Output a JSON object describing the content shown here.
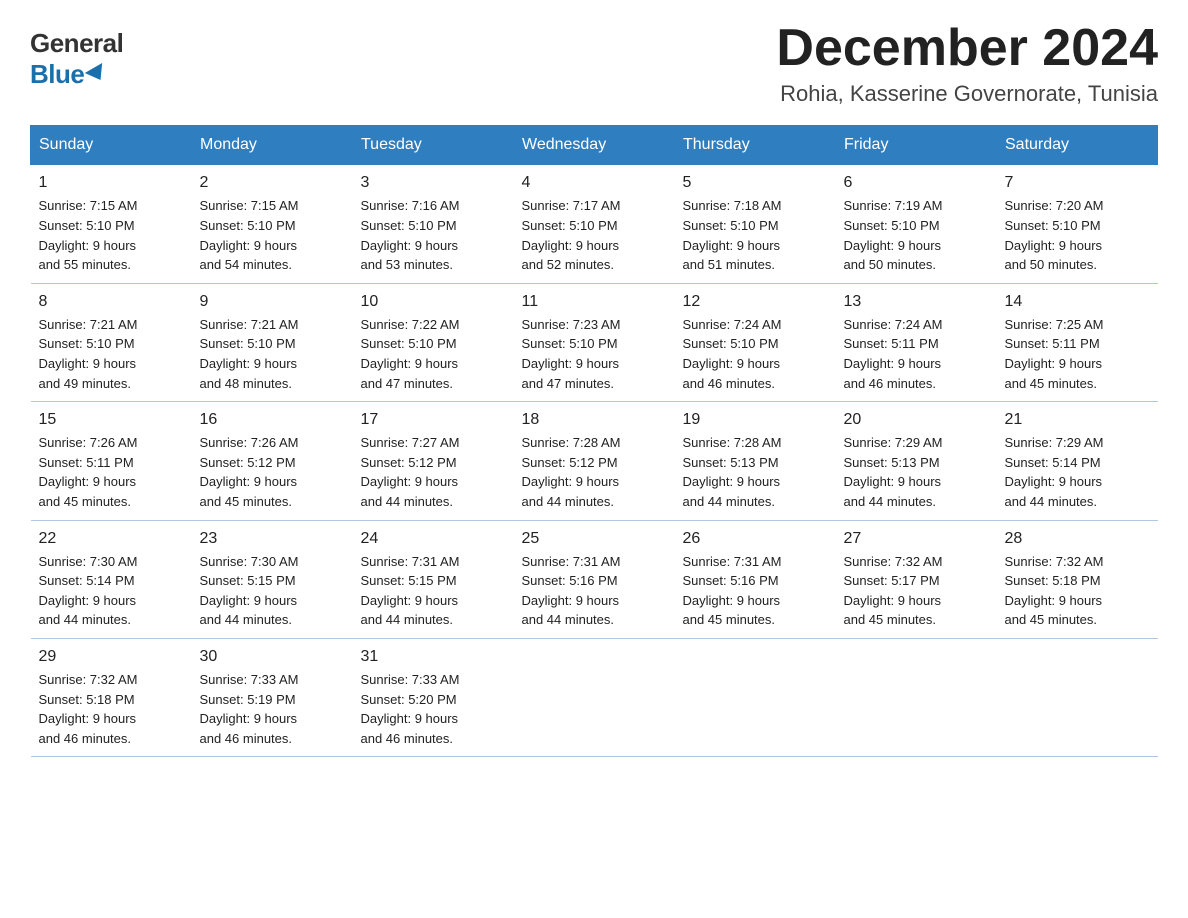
{
  "logo": {
    "general": "General",
    "blue": "Blue"
  },
  "header": {
    "month": "December 2024",
    "location": "Rohia, Kasserine Governorate, Tunisia"
  },
  "days_of_week": [
    "Sunday",
    "Monday",
    "Tuesday",
    "Wednesday",
    "Thursday",
    "Friday",
    "Saturday"
  ],
  "weeks": [
    [
      {
        "day": "1",
        "sunrise": "7:15 AM",
        "sunset": "5:10 PM",
        "daylight": "9 hours and 55 minutes."
      },
      {
        "day": "2",
        "sunrise": "7:15 AM",
        "sunset": "5:10 PM",
        "daylight": "9 hours and 54 minutes."
      },
      {
        "day": "3",
        "sunrise": "7:16 AM",
        "sunset": "5:10 PM",
        "daylight": "9 hours and 53 minutes."
      },
      {
        "day": "4",
        "sunrise": "7:17 AM",
        "sunset": "5:10 PM",
        "daylight": "9 hours and 52 minutes."
      },
      {
        "day": "5",
        "sunrise": "7:18 AM",
        "sunset": "5:10 PM",
        "daylight": "9 hours and 51 minutes."
      },
      {
        "day": "6",
        "sunrise": "7:19 AM",
        "sunset": "5:10 PM",
        "daylight": "9 hours and 50 minutes."
      },
      {
        "day": "7",
        "sunrise": "7:20 AM",
        "sunset": "5:10 PM",
        "daylight": "9 hours and 50 minutes."
      }
    ],
    [
      {
        "day": "8",
        "sunrise": "7:21 AM",
        "sunset": "5:10 PM",
        "daylight": "9 hours and 49 minutes."
      },
      {
        "day": "9",
        "sunrise": "7:21 AM",
        "sunset": "5:10 PM",
        "daylight": "9 hours and 48 minutes."
      },
      {
        "day": "10",
        "sunrise": "7:22 AM",
        "sunset": "5:10 PM",
        "daylight": "9 hours and 47 minutes."
      },
      {
        "day": "11",
        "sunrise": "7:23 AM",
        "sunset": "5:10 PM",
        "daylight": "9 hours and 47 minutes."
      },
      {
        "day": "12",
        "sunrise": "7:24 AM",
        "sunset": "5:10 PM",
        "daylight": "9 hours and 46 minutes."
      },
      {
        "day": "13",
        "sunrise": "7:24 AM",
        "sunset": "5:11 PM",
        "daylight": "9 hours and 46 minutes."
      },
      {
        "day": "14",
        "sunrise": "7:25 AM",
        "sunset": "5:11 PM",
        "daylight": "9 hours and 45 minutes."
      }
    ],
    [
      {
        "day": "15",
        "sunrise": "7:26 AM",
        "sunset": "5:11 PM",
        "daylight": "9 hours and 45 minutes."
      },
      {
        "day": "16",
        "sunrise": "7:26 AM",
        "sunset": "5:12 PM",
        "daylight": "9 hours and 45 minutes."
      },
      {
        "day": "17",
        "sunrise": "7:27 AM",
        "sunset": "5:12 PM",
        "daylight": "9 hours and 44 minutes."
      },
      {
        "day": "18",
        "sunrise": "7:28 AM",
        "sunset": "5:12 PM",
        "daylight": "9 hours and 44 minutes."
      },
      {
        "day": "19",
        "sunrise": "7:28 AM",
        "sunset": "5:13 PM",
        "daylight": "9 hours and 44 minutes."
      },
      {
        "day": "20",
        "sunrise": "7:29 AM",
        "sunset": "5:13 PM",
        "daylight": "9 hours and 44 minutes."
      },
      {
        "day": "21",
        "sunrise": "7:29 AM",
        "sunset": "5:14 PM",
        "daylight": "9 hours and 44 minutes."
      }
    ],
    [
      {
        "day": "22",
        "sunrise": "7:30 AM",
        "sunset": "5:14 PM",
        "daylight": "9 hours and 44 minutes."
      },
      {
        "day": "23",
        "sunrise": "7:30 AM",
        "sunset": "5:15 PM",
        "daylight": "9 hours and 44 minutes."
      },
      {
        "day": "24",
        "sunrise": "7:31 AM",
        "sunset": "5:15 PM",
        "daylight": "9 hours and 44 minutes."
      },
      {
        "day": "25",
        "sunrise": "7:31 AM",
        "sunset": "5:16 PM",
        "daylight": "9 hours and 44 minutes."
      },
      {
        "day": "26",
        "sunrise": "7:31 AM",
        "sunset": "5:16 PM",
        "daylight": "9 hours and 45 minutes."
      },
      {
        "day": "27",
        "sunrise": "7:32 AM",
        "sunset": "5:17 PM",
        "daylight": "9 hours and 45 minutes."
      },
      {
        "day": "28",
        "sunrise": "7:32 AM",
        "sunset": "5:18 PM",
        "daylight": "9 hours and 45 minutes."
      }
    ],
    [
      {
        "day": "29",
        "sunrise": "7:32 AM",
        "sunset": "5:18 PM",
        "daylight": "9 hours and 46 minutes."
      },
      {
        "day": "30",
        "sunrise": "7:33 AM",
        "sunset": "5:19 PM",
        "daylight": "9 hours and 46 minutes."
      },
      {
        "day": "31",
        "sunrise": "7:33 AM",
        "sunset": "5:20 PM",
        "daylight": "9 hours and 46 minutes."
      },
      null,
      null,
      null,
      null
    ]
  ],
  "labels": {
    "sunrise": "Sunrise:",
    "sunset": "Sunset:",
    "daylight": "Daylight:"
  }
}
